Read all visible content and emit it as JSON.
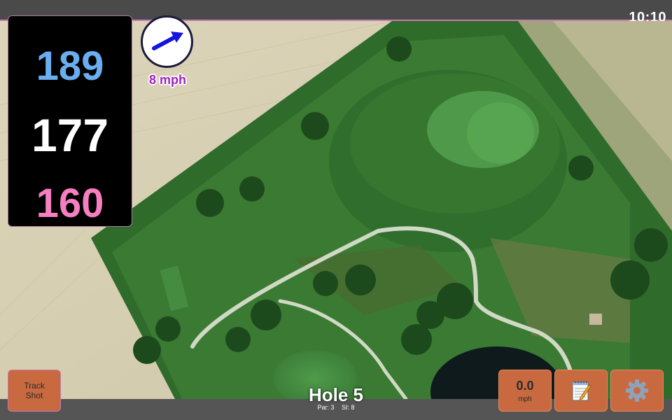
{
  "status_bar": {
    "time": "10:10"
  },
  "distances": {
    "back": "189",
    "middle": "177",
    "front": "160"
  },
  "wind": {
    "speed": "8 mph",
    "arrow_icon": "arrow-icon",
    "arrow_color": "#1414e0"
  },
  "buttons": {
    "track_shot_line1": "Track",
    "track_shot_line2": "Shot",
    "speed_value": "0.0",
    "speed_unit": "mph",
    "notes_icon": "notepad-icon",
    "settings_icon": "gear-icon"
  },
  "hole": {
    "title": "Hole 5",
    "par": "Par: 3",
    "si": "SI: 8"
  },
  "colors": {
    "accent_border": "#c87ab8",
    "button_bg": "#c8693f",
    "back_distance": "#6aaef0",
    "middle_distance": "#ffffff",
    "front_distance": "#f57fc0",
    "wind_text": "#a020c0"
  }
}
